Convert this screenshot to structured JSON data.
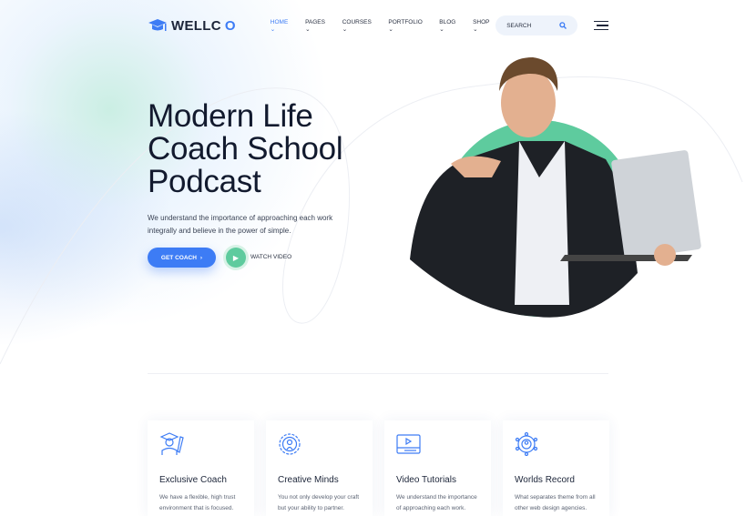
{
  "brand": {
    "name_main": "WELLC",
    "name_accent": "O",
    "accent": "#3d7cf5",
    "green": "#5ecb9e"
  },
  "nav": {
    "items": [
      {
        "label": "HOME",
        "active": true
      },
      {
        "label": "PAGES"
      },
      {
        "label": "COURSES"
      },
      {
        "label": "PORTFOLIO"
      },
      {
        "label": "BLOG"
      },
      {
        "label": "SHOP"
      }
    ],
    "search_placeholder": "SEARCH"
  },
  "hero": {
    "title_l1": "Modern Life",
    "title_l2": "Coach School",
    "title_l3": "Podcast",
    "lead": "We understand the importance of approaching each work integrally and believe in the power of simple.",
    "cta": "GET COACH",
    "watch": "WATCH VIDEO"
  },
  "features": [
    {
      "icon": "graduate-icon",
      "title": "Exclusive Coach",
      "text": "We have a flexible, high trust environment that is focused."
    },
    {
      "icon": "gear-mind-icon",
      "title": "Creative Minds",
      "text": "You not only develop your craft but your ability to partner."
    },
    {
      "icon": "video-icon",
      "title": "Video Tutorials",
      "text": "We understand the importance of approaching each work."
    },
    {
      "icon": "network-icon",
      "title": "Worlds Record",
      "text": "What separates theme from all other web design agencies."
    }
  ]
}
